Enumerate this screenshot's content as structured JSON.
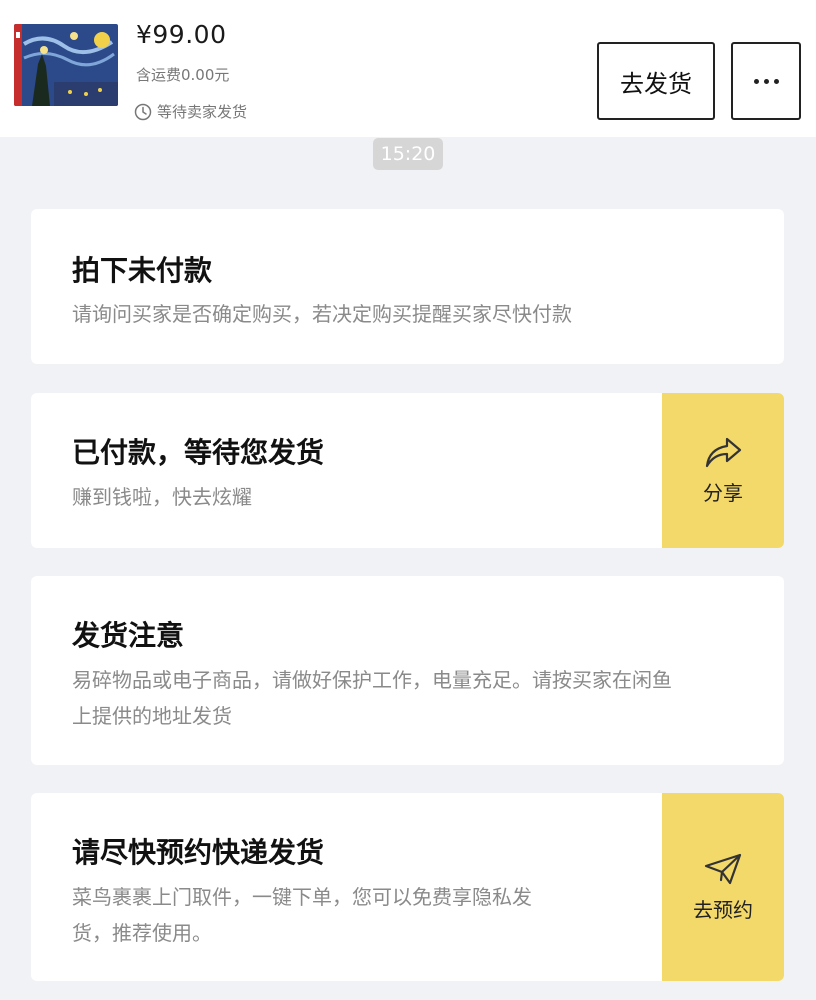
{
  "order": {
    "price": "¥99.00",
    "shipping_fee": "含运费0.00元",
    "status": "等待卖家发货",
    "status_icon": "clock-icon",
    "thumbnail_icon": "starry-night-puzzle-image"
  },
  "actions": {
    "ship_button": "去发货",
    "more_icon": "more-dots-icon"
  },
  "chat": {
    "timestamp": "15:20"
  },
  "cards": [
    {
      "title": "拍下未付款",
      "desc": "请询问买家是否确定购买，若决定购买提醒买家尽快付款"
    },
    {
      "title": "已付款，等待您发货",
      "desc": "赚到钱啦，快去炫耀",
      "action_label": "分享",
      "action_icon": "share-arrow-icon",
      "action_color": "#f3d86a"
    },
    {
      "title": "发货注意",
      "desc_line1": "易碎物品或电子商品，请做好保护工作，电量充足。请按买家在闲鱼",
      "desc_line2": "上提供的地址发货"
    },
    {
      "title": "请尽快预约快递发货",
      "desc_line1": "菜鸟裹裹上门取件，一键下单，您可以免费享隐私发",
      "desc_line2": "货，推荐使用。",
      "action_label": "去预约",
      "action_icon": "paper-plane-icon",
      "action_color": "#f3d86a"
    }
  ]
}
